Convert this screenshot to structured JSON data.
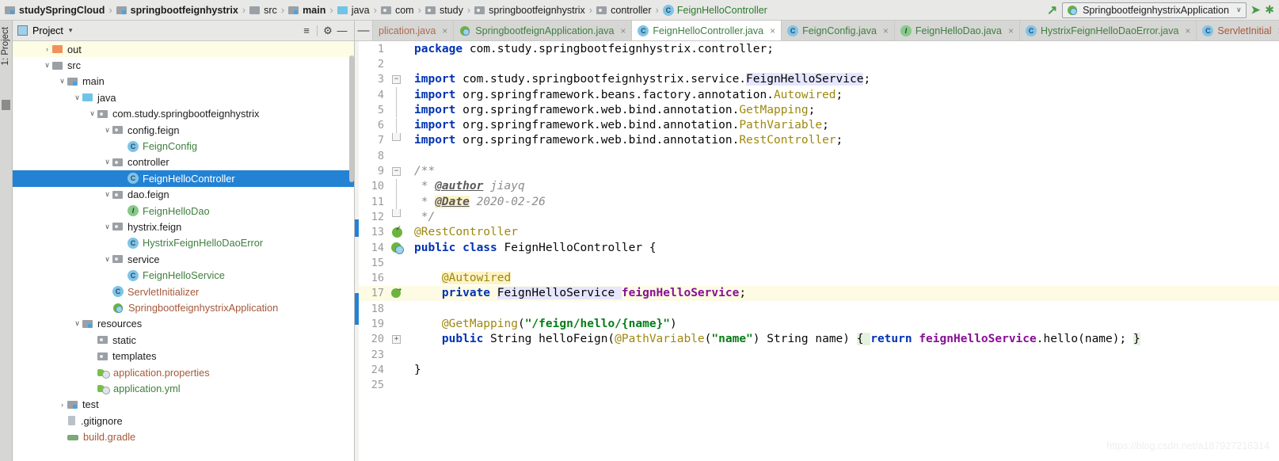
{
  "navbar": {
    "breadcrumbs": [
      {
        "label": "studySpringCloud",
        "icon": "module-icon",
        "bold": true
      },
      {
        "label": "springbootfeignhystrix",
        "icon": "module-icon",
        "bold": true
      },
      {
        "label": "src",
        "icon": "folder-icon",
        "bold": false
      },
      {
        "label": "main",
        "icon": "module-icon",
        "bold": true
      },
      {
        "label": "java",
        "icon": "folder-blue-icon",
        "bold": false
      },
      {
        "label": "com",
        "icon": "package-icon",
        "bold": false
      },
      {
        "label": "study",
        "icon": "package-icon",
        "bold": false
      },
      {
        "label": "springbootfeignhystrix",
        "icon": "package-icon",
        "bold": false
      },
      {
        "label": "controller",
        "icon": "package-icon",
        "bold": false
      },
      {
        "label": "FeignHelloController",
        "icon": "class-icon",
        "bold": false,
        "klass": true
      }
    ],
    "separator": "›",
    "run_config": "SpringbootfeignhystrixApplication",
    "run_config_caret": "∨",
    "back_arrow": "↖",
    "run_button": "➤",
    "debug_button": "✱"
  },
  "left_strip": {
    "project_tab": "1: Project"
  },
  "project_panel": {
    "title": "Project",
    "caret": "▾",
    "collapse_all_icon": "≡",
    "settings_icon": "⚙",
    "hide_icon": "—",
    "tree": [
      {
        "indent": 1,
        "arrow": "›",
        "icon": "folder-orange-icon",
        "label": "out",
        "color": "plain",
        "state": "out-highlight"
      },
      {
        "indent": 1,
        "arrow": "∨",
        "icon": "folder-icon",
        "label": "src",
        "color": "plain",
        "state": ""
      },
      {
        "indent": 2,
        "arrow": "∨",
        "icon": "module-icon",
        "label": "main",
        "color": "plain",
        "state": ""
      },
      {
        "indent": 3,
        "arrow": "∨",
        "icon": "folder-blue-icon",
        "label": "java",
        "color": "plain",
        "state": ""
      },
      {
        "indent": 4,
        "arrow": "∨",
        "icon": "package-icon",
        "label": "com.study.springbootfeignhystrix",
        "color": "plain",
        "state": ""
      },
      {
        "indent": 5,
        "arrow": "∨",
        "icon": "package-icon",
        "label": "config.feign",
        "color": "plain",
        "state": ""
      },
      {
        "indent": 6,
        "arrow": "",
        "icon": "class-icon",
        "label": "FeignConfig",
        "color": "green",
        "state": ""
      },
      {
        "indent": 5,
        "arrow": "∨",
        "icon": "package-icon",
        "label": "controller",
        "color": "plain",
        "state": ""
      },
      {
        "indent": 6,
        "arrow": "",
        "icon": "class-icon",
        "label": "FeignHelloController",
        "color": "green",
        "state": "selected"
      },
      {
        "indent": 5,
        "arrow": "∨",
        "icon": "package-icon",
        "label": "dao.feign",
        "color": "plain",
        "state": ""
      },
      {
        "indent": 6,
        "arrow": "",
        "icon": "interface-icon",
        "label": "FeignHelloDao",
        "color": "green",
        "state": ""
      },
      {
        "indent": 5,
        "arrow": "∨",
        "icon": "package-icon",
        "label": "hystrix.feign",
        "color": "plain",
        "state": ""
      },
      {
        "indent": 6,
        "arrow": "",
        "icon": "class-icon",
        "label": "HystrixFeignHelloDaoError",
        "color": "green",
        "state": ""
      },
      {
        "indent": 5,
        "arrow": "∨",
        "icon": "package-icon",
        "label": "service",
        "color": "plain",
        "state": ""
      },
      {
        "indent": 6,
        "arrow": "",
        "icon": "class-icon",
        "label": "FeignHelloService",
        "color": "green",
        "state": ""
      },
      {
        "indent": 5,
        "arrow": "",
        "icon": "class-icon",
        "label": "ServletInitializer",
        "color": "brown",
        "state": ""
      },
      {
        "indent": 5,
        "arrow": "",
        "icon": "spring-class-icon",
        "label": "SpringbootfeignhystrixApplication",
        "color": "brown",
        "state": ""
      },
      {
        "indent": 3,
        "arrow": "∨",
        "icon": "resources-icon",
        "label": "resources",
        "color": "plain",
        "state": ""
      },
      {
        "indent": 4,
        "arrow": "",
        "icon": "package-icon",
        "label": "static",
        "color": "plain",
        "state": ""
      },
      {
        "indent": 4,
        "arrow": "",
        "icon": "package-icon",
        "label": "templates",
        "color": "plain",
        "state": ""
      },
      {
        "indent": 4,
        "arrow": "",
        "icon": "yml-icon",
        "label": "application.properties",
        "color": "brown",
        "state": ""
      },
      {
        "indent": 4,
        "arrow": "",
        "icon": "yml-icon",
        "label": "application.yml",
        "color": "green",
        "state": ""
      },
      {
        "indent": 2,
        "arrow": "›",
        "icon": "module-icon",
        "label": "test",
        "color": "plain",
        "state": ""
      },
      {
        "indent": 2,
        "arrow": "",
        "icon": "gitignore-icon",
        "label": ".gitignore",
        "color": "plain",
        "state": ""
      },
      {
        "indent": 2,
        "arrow": "",
        "icon": "gradle-icon",
        "label": "build.gradle",
        "color": "brown",
        "state": ""
      }
    ]
  },
  "editor_tabs": {
    "minus_label": "—",
    "close_glyph": "×",
    "tabs": [
      {
        "label": "plication.java",
        "icon": "none",
        "color": "fade",
        "active": false
      },
      {
        "label": "SpringbootfeignApplication.java",
        "icon": "spring-class-icon",
        "color": "green",
        "active": false
      },
      {
        "label": "FeignHelloController.java",
        "icon": "class-icon",
        "color": "green",
        "active": true
      },
      {
        "label": "FeignConfig.java",
        "icon": "class-icon",
        "color": "green",
        "active": false
      },
      {
        "label": "FeignHelloDao.java",
        "icon": "interface-icon",
        "color": "green",
        "active": false
      },
      {
        "label": "HystrixFeignHelloDaoError.java",
        "icon": "class-icon",
        "color": "green",
        "active": false
      },
      {
        "label": "ServletInitial",
        "icon": "class-icon",
        "color": "brown",
        "active": false
      }
    ]
  },
  "editor": {
    "watermark": "https://blog.csdn.net/a187927218314",
    "lines": [
      {
        "num": "1",
        "gutter": "",
        "current": false,
        "tokens": [
          {
            "t": "package ",
            "c": "kw"
          },
          {
            "t": "com.study.springbootfeignhystrix.controller;",
            "c": "plain"
          }
        ]
      },
      {
        "num": "2",
        "gutter": "",
        "current": false,
        "tokens": []
      },
      {
        "num": "3",
        "gutter": "fold-start",
        "current": false,
        "tokens": [
          {
            "t": "import ",
            "c": "kw"
          },
          {
            "t": "com.study.springbootfeignhystrix.service.",
            "c": "plain"
          },
          {
            "t": "FeignHelloService",
            "c": "hlid"
          },
          {
            "t": ";",
            "c": "plain"
          }
        ]
      },
      {
        "num": "4",
        "gutter": "foldline",
        "current": false,
        "tokens": [
          {
            "t": "import ",
            "c": "kw"
          },
          {
            "t": "org.springframework.beans.factory.annotation.",
            "c": "plain"
          },
          {
            "t": "Autowired",
            "c": "anno"
          },
          {
            "t": ";",
            "c": "plain"
          }
        ]
      },
      {
        "num": "5",
        "gutter": "foldline",
        "current": false,
        "tokens": [
          {
            "t": "import ",
            "c": "kw"
          },
          {
            "t": "org.springframework.web.bind.annotation.",
            "c": "plain"
          },
          {
            "t": "GetMapping",
            "c": "anno"
          },
          {
            "t": ";",
            "c": "plain"
          }
        ]
      },
      {
        "num": "6",
        "gutter": "foldline",
        "current": false,
        "tokens": [
          {
            "t": "import ",
            "c": "kw"
          },
          {
            "t": "org.springframework.web.bind.annotation.",
            "c": "plain"
          },
          {
            "t": "PathVariable",
            "c": "anno"
          },
          {
            "t": ";",
            "c": "plain"
          }
        ]
      },
      {
        "num": "7",
        "gutter": "fold-end",
        "current": false,
        "tokens": [
          {
            "t": "import ",
            "c": "kw"
          },
          {
            "t": "org.springframework.web.bind.annotation.",
            "c": "plain"
          },
          {
            "t": "RestController",
            "c": "anno"
          },
          {
            "t": ";",
            "c": "plain"
          }
        ]
      },
      {
        "num": "8",
        "gutter": "",
        "current": false,
        "tokens": []
      },
      {
        "num": "9",
        "gutter": "fold-start",
        "current": false,
        "tokens": [
          {
            "t": "/**",
            "c": "cmt"
          }
        ]
      },
      {
        "num": "10",
        "gutter": "foldline",
        "current": false,
        "tokens": [
          {
            "t": " * ",
            "c": "cmt"
          },
          {
            "t": "@author",
            "c": "cmttag"
          },
          {
            "t": " jiayq",
            "c": "cmt"
          }
        ]
      },
      {
        "num": "11",
        "gutter": "foldline",
        "current": false,
        "tokens": [
          {
            "t": " * ",
            "c": "cmt"
          },
          {
            "t": "@Date",
            "c": "cmttag-hl"
          },
          {
            "t": " 2020-02-26",
            "c": "cmt"
          }
        ]
      },
      {
        "num": "12",
        "gutter": "fold-end",
        "current": false,
        "tokens": [
          {
            "t": " */",
            "c": "cmt"
          }
        ]
      },
      {
        "num": "13",
        "gutter": "bean",
        "current": false,
        "tokens": [
          {
            "t": "@RestController",
            "c": "anno"
          }
        ]
      },
      {
        "num": "14",
        "gutter": "bean-class",
        "current": false,
        "tokens": [
          {
            "t": "public class ",
            "c": "kw"
          },
          {
            "t": "FeignHelloController {",
            "c": "plain"
          }
        ]
      },
      {
        "num": "15",
        "gutter": "",
        "current": false,
        "tokens": []
      },
      {
        "num": "16",
        "gutter": "",
        "current": false,
        "tokens": [
          {
            "t": "    ",
            "c": "plain"
          },
          {
            "t": "@Autowired",
            "c": "anno-hl"
          }
        ]
      },
      {
        "num": "17",
        "gutter": "arrow",
        "current": true,
        "tokens": [
          {
            "t": "    ",
            "c": "plain"
          },
          {
            "t": "private ",
            "c": "kw"
          },
          {
            "t": "FeignHelloService",
            "c": "hlid"
          },
          {
            "t": " ",
            "c": "hlid"
          },
          {
            "t": "feignHelloService",
            "c": "fld"
          },
          {
            "t": ";",
            "c": "plain"
          }
        ]
      },
      {
        "num": "18",
        "gutter": "",
        "current": false,
        "tokens": []
      },
      {
        "num": "19",
        "gutter": "",
        "current": false,
        "tokens": [
          {
            "t": "    ",
            "c": "plain"
          },
          {
            "t": "@GetMapping",
            "c": "anno"
          },
          {
            "t": "(",
            "c": "plain"
          },
          {
            "t": "\"/feign/hello/{name}\"",
            "c": "str"
          },
          {
            "t": ")",
            "c": "plain"
          }
        ]
      },
      {
        "num": "20",
        "gutter": "fold-plus",
        "current": false,
        "tokens": [
          {
            "t": "    ",
            "c": "plain"
          },
          {
            "t": "public ",
            "c": "kw"
          },
          {
            "t": "String helloFeign(",
            "c": "plain"
          },
          {
            "t": "@PathVariable",
            "c": "anno"
          },
          {
            "t": "(",
            "c": "plain"
          },
          {
            "t": "\"name\"",
            "c": "str"
          },
          {
            "t": ") String name) ",
            "c": "plain"
          },
          {
            "t": "{ ",
            "c": "folded"
          },
          {
            "t": "return ",
            "c": "kw"
          },
          {
            "t": "feignHelloService",
            "c": "fld"
          },
          {
            "t": ".hello(name); ",
            "c": "plain"
          },
          {
            "t": "}",
            "c": "folded"
          }
        ]
      },
      {
        "num": "23",
        "gutter": "",
        "current": false,
        "tokens": []
      },
      {
        "num": "24",
        "gutter": "",
        "current": false,
        "tokens": [
          {
            "t": "}",
            "c": "plain"
          }
        ]
      },
      {
        "num": "25",
        "gutter": "",
        "current": false,
        "tokens": []
      }
    ]
  }
}
